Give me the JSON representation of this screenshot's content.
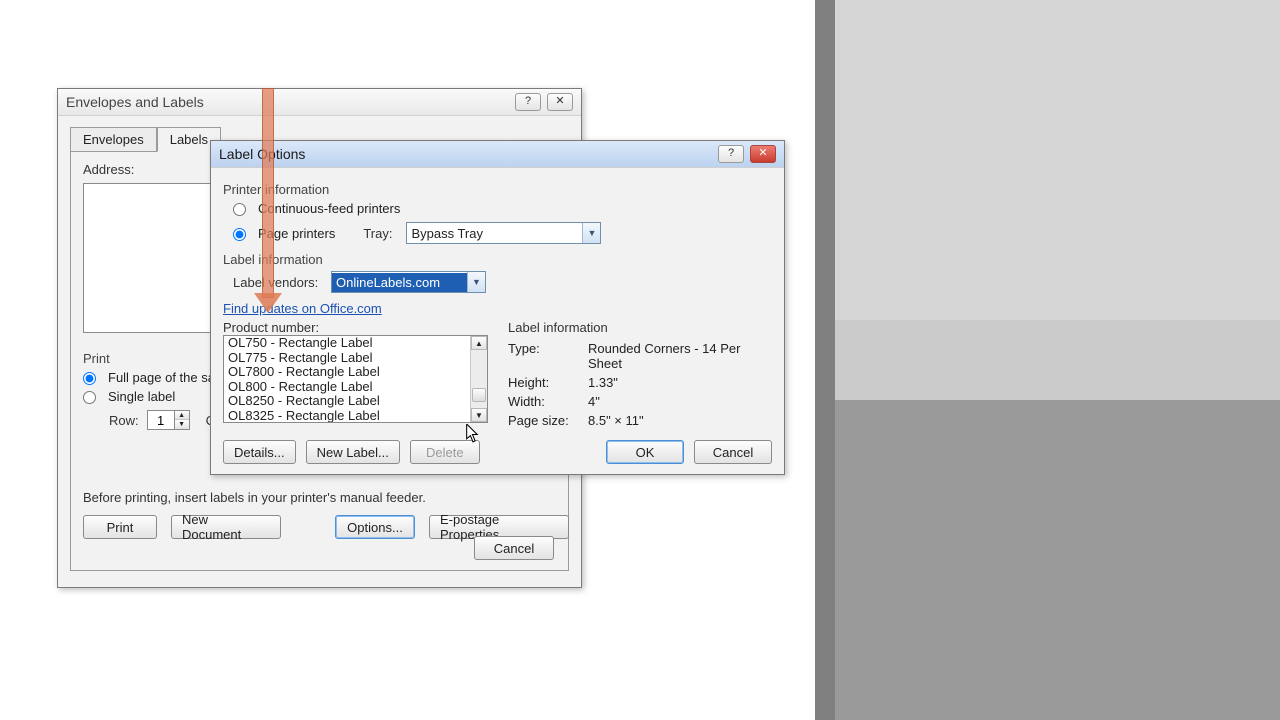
{
  "bgDialog": {
    "title": "Envelopes and Labels",
    "helpGlyph": "?",
    "closeGlyph": "✕",
    "tabs": [
      "Envelopes",
      "Labels"
    ],
    "activeTab": 1,
    "addressLabel": "Address:",
    "printSection": "Print",
    "fullPageRadio": "Full page of the sam",
    "singleLabelRadio": "Single label",
    "rowLabel": "Row:",
    "rowValue": "1",
    "colCutoff": "C",
    "printNote": "Before printing, insert labels in your printer's manual feeder.",
    "buttons": {
      "print": "Print",
      "newDoc": "New Document",
      "options": "Options...",
      "epostage": "E-postage Properties...",
      "cancel": "Cancel"
    }
  },
  "optDialog": {
    "title": "Label Options",
    "helpGlyph": "?",
    "closeGlyph": "✕",
    "printerInfoHead": "Printer information",
    "continuousRadio": "Continuous-feed printers",
    "pagePrintersRadio": "Page printers",
    "trayLabel": "Tray:",
    "trayValue": "Bypass Tray",
    "labelInfoHead": "Label information",
    "vendorLabel": "Label vendors:",
    "vendorValue": "OnlineLabels.com",
    "updatesLink": "Find updates on Office.com",
    "productNumberHead": "Product number:",
    "products": [
      "OL750 - Rectangle Label",
      "OL775 - Rectangle Label",
      "OL7800 - Rectangle Label",
      "OL800 - Rectangle Label",
      "OL8250 - Rectangle Label",
      "OL8325 - Rectangle Label"
    ],
    "labelInfoHead2": "Label information",
    "info": {
      "typeLabel": "Type:",
      "typeValue": "Rounded Corners - 14 Per Sheet",
      "heightLabel": "Height:",
      "heightValue": "1.33\"",
      "widthLabel": "Width:",
      "widthValue": "4\"",
      "pageLabel": "Page size:",
      "pageValue": "8.5\" × 11\""
    },
    "buttons": {
      "details": "Details...",
      "newLabel": "New Label...",
      "delete": "Delete",
      "ok": "OK",
      "cancel": "Cancel"
    }
  }
}
